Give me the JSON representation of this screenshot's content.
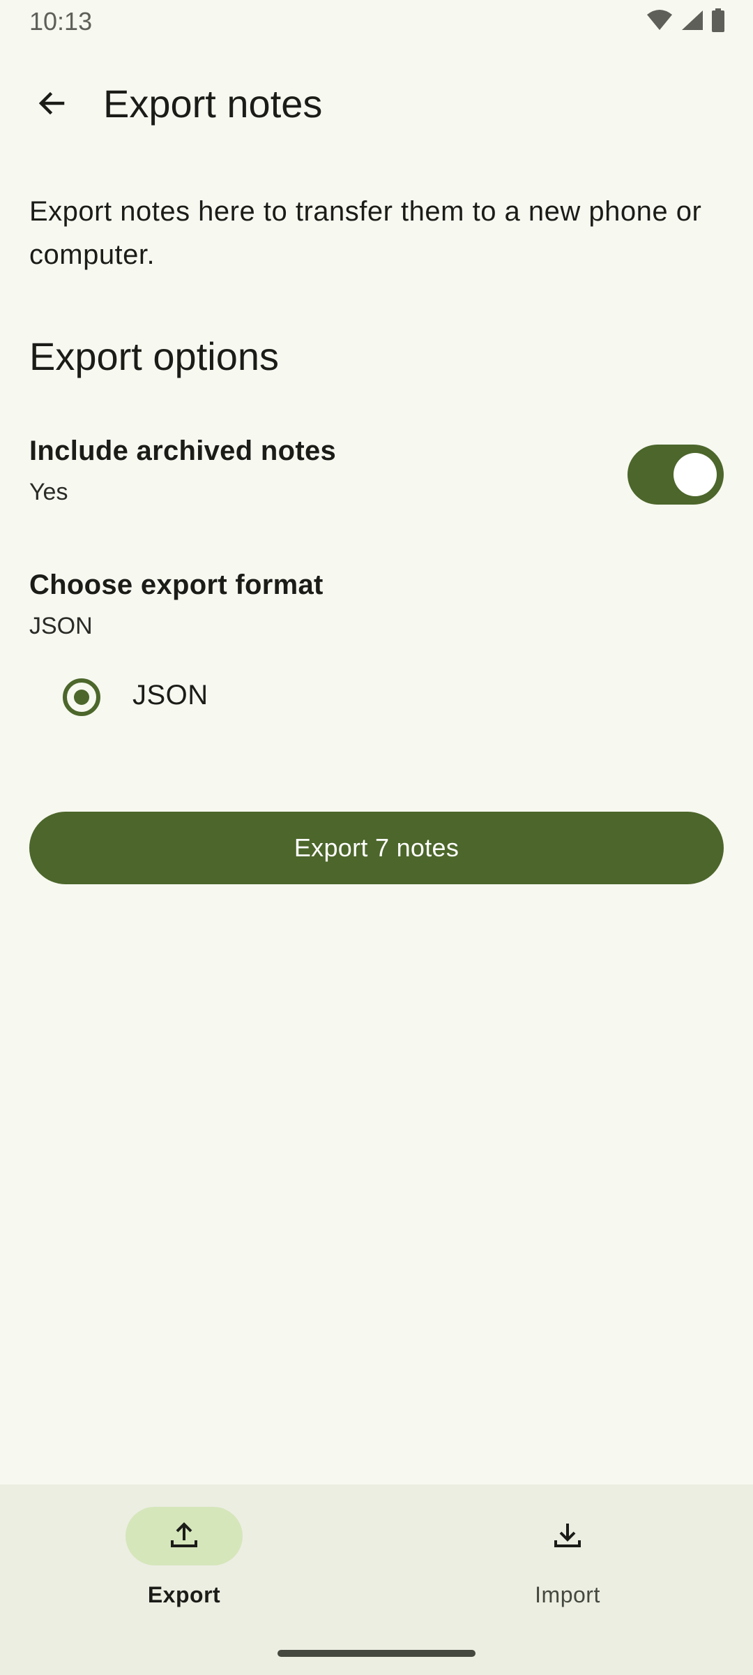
{
  "status_bar": {
    "time": "10:13",
    "icons": [
      "wifi-icon",
      "signal-icon",
      "battery-icon"
    ]
  },
  "app_bar": {
    "back_icon": "arrow-back-icon",
    "title": "Export notes"
  },
  "description": "Export notes here to transfer them to a new phone or computer.",
  "section": {
    "title": "Export options"
  },
  "include_archived": {
    "title": "Include archived notes",
    "summary": "Yes",
    "enabled": true
  },
  "export_format": {
    "title": "Choose export format",
    "summary": "JSON",
    "options": [
      {
        "label": "JSON",
        "selected": true
      }
    ]
  },
  "export_button": {
    "label": "Export 7 notes"
  },
  "bottom_nav": {
    "items": [
      {
        "label": "Export",
        "icon": "upload-icon",
        "active": true
      },
      {
        "label": "Import",
        "icon": "download-icon",
        "active": false
      }
    ]
  },
  "colors": {
    "background": "#f7f8f0",
    "primary": "#4c662b",
    "nav_background": "#eceee2",
    "nav_indicator": "#d5e6bb"
  }
}
